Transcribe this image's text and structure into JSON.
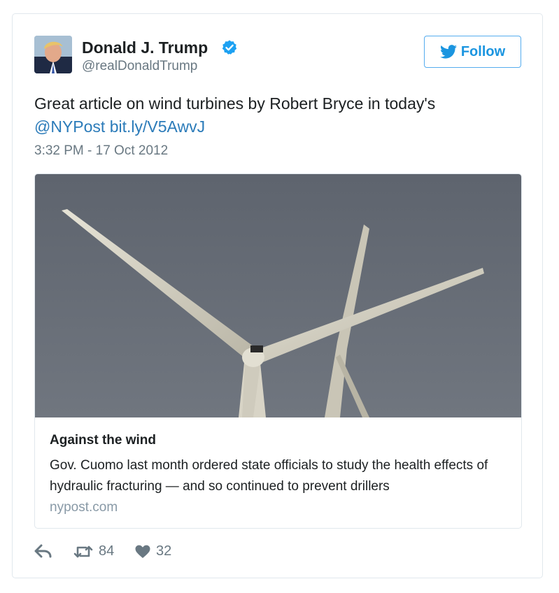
{
  "tweet": {
    "author_name": "Donald J. Trump",
    "handle": "@realDonaldTrump",
    "follow_label": "Follow",
    "text_main": "Great article on wind turbines by Robert Bryce in today's",
    "mention": "@NYPost",
    "short_link": "bit.ly/V5AwvJ",
    "timestamp": "3:32 PM - 17 Oct 2012"
  },
  "card": {
    "title": "Against the wind",
    "description": "Gov. Cuomo last month ordered state officials to study the health effects of hydraulic fracturing — and so continued to prevent drillers",
    "domain": "nypost.com",
    "image_subject": "wind-turbine-photo"
  },
  "actions": {
    "reply_icon": "reply-icon",
    "retweet_icon": "retweet-icon",
    "retweet_count": "84",
    "like_icon": "heart-icon",
    "like_count": "32"
  },
  "colors": {
    "link": "#2b7bb9",
    "follow_accent": "#1b95e0",
    "verified": "#1da1f2",
    "muted_text": "#697882",
    "border": "#e1e8ed"
  }
}
